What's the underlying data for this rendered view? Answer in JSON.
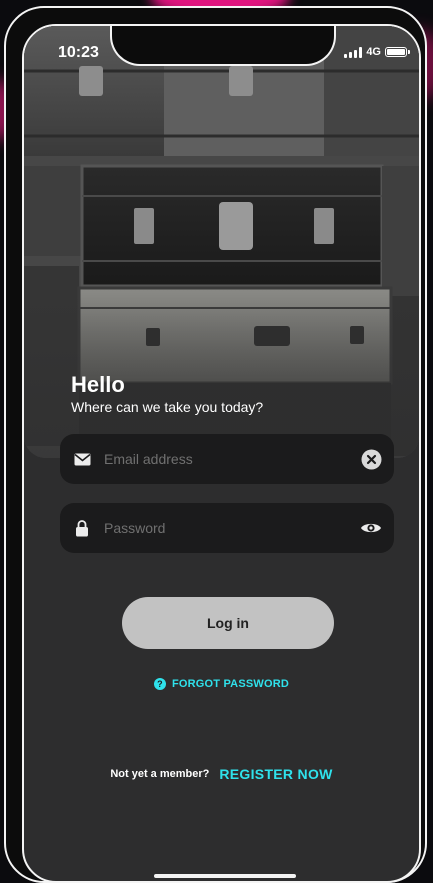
{
  "status_bar": {
    "time": "10:23",
    "network": "4G",
    "icons": [
      "signal-icon",
      "battery-icon"
    ]
  },
  "hero": {
    "image": "stacked vintage trunks photo",
    "greeting": "Hello",
    "tagline": "Where can we take you today?"
  },
  "form": {
    "email": {
      "placeholder": "Email address",
      "value": "",
      "lead_icon": "envelope-icon",
      "trail_icon": "clear-icon"
    },
    "password": {
      "placeholder": "Password",
      "value": "",
      "lead_icon": "lock-icon",
      "trail_icon": "eye-icon"
    },
    "login_label": "Log in"
  },
  "forgot": {
    "label": "FORGOT PASSWORD",
    "icon_glyph": "?",
    "icon": "question-icon"
  },
  "register": {
    "prompt": "Not yet a member?",
    "link_label": "REGISTER NOW"
  },
  "colors": {
    "background": "#2d2d2e",
    "field": "#1b1b1c",
    "accent": "#2fe2ec",
    "button": "#c2c2c2",
    "frame": "#f4f4f4"
  }
}
